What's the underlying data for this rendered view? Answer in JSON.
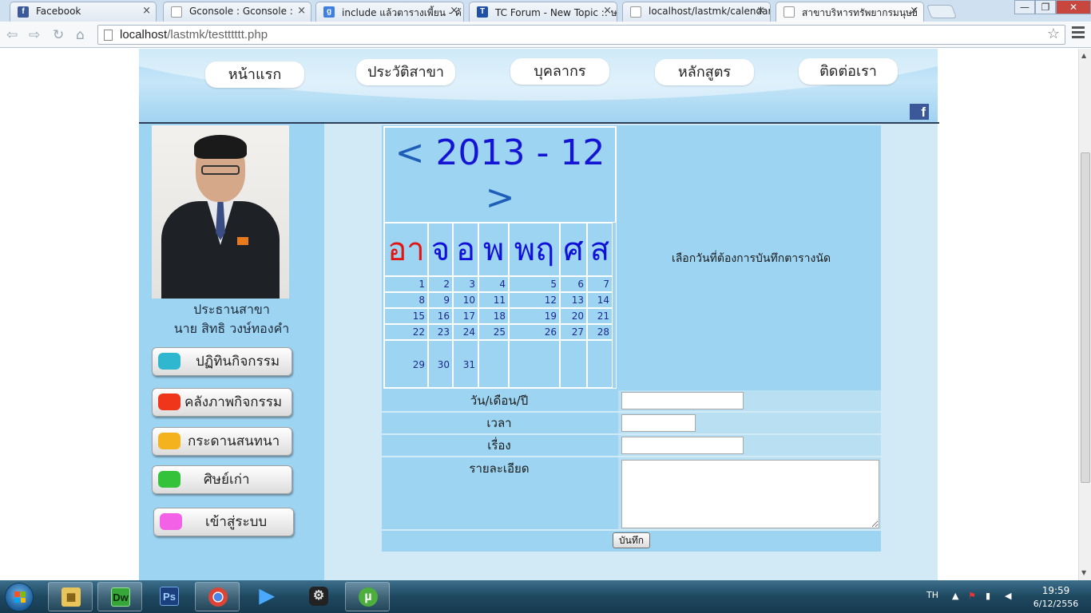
{
  "browser": {
    "tabs": [
      {
        "title": "Facebook",
        "icon": "facebook-icon",
        "icon_color": "#3b5998",
        "icon_glyph": "f"
      },
      {
        "title": "Gconsole : Gconsole :",
        "icon": "page-icon",
        "icon_color": "#ffffff",
        "icon_glyph": ""
      },
      {
        "title": "include แล้วตารางเพี้ยน - ค้",
        "icon": "google-icon",
        "icon_color": "#3f7fe0",
        "icon_glyph": "g"
      },
      {
        "title": "TC Forum - New Topic :: ษ",
        "icon": "forum-icon",
        "icon_color": "#1f4fa6",
        "icon_glyph": "T"
      },
      {
        "title": "localhost/lastmk/calendar",
        "icon": "page-icon",
        "icon_color": "#ffffff",
        "icon_glyph": ""
      },
      {
        "title": "สาขาบริหารทรัพยากรมนุษย์",
        "icon": "page-icon",
        "icon_color": "#ffffff",
        "icon_glyph": ""
      }
    ],
    "close_glyph": "×",
    "window_buttons": {
      "minimize": "—",
      "restore": "❐",
      "close": "✕"
    },
    "nav": {
      "back": "⇦",
      "forward": "⇨",
      "reload": "↻",
      "home": "⌂"
    },
    "url_host": "localhost",
    "url_path": "/lastmk/testttttt.php",
    "star": "☆"
  },
  "site": {
    "nav": [
      "หน้าแรก",
      "ประวัติสาขา",
      "บุคลากร",
      "หลักสูตร",
      "ติดต่อเรา"
    ],
    "facebook_glyph": "f",
    "chair_title": "ประธานสาขา",
    "chair_name": "นาย สิทธิ วงษ์ทองคำ",
    "menu": [
      {
        "label": "ปฏิทินกิจกรรม",
        "color": "#2fb7cf"
      },
      {
        "label": "คลังภาพกิจกรรม",
        "color": "#f0361a"
      },
      {
        "label": "กระดานสนทนา",
        "color": "#f3b21e"
      },
      {
        "label": "ศิษย์เก่า",
        "color": "#33c23a"
      },
      {
        "label": "เข้าสู่ระบบ",
        "color": "#f261e6"
      }
    ],
    "calendar": {
      "prev": "<",
      "next": ">",
      "year_month": "2013 - 12",
      "weekdays": [
        "อา",
        "จ",
        "อ",
        "พ",
        "พฤ",
        "ศ",
        "ส"
      ],
      "weeks": [
        [
          "1",
          "2",
          "3",
          "4",
          "5",
          "6",
          "7"
        ],
        [
          "8",
          "9",
          "10",
          "11",
          "12",
          "13",
          "14"
        ],
        [
          "15",
          "16",
          "17",
          "18",
          "19",
          "20",
          "21"
        ],
        [
          "22",
          "23",
          "24",
          "25",
          "26",
          "27",
          "28"
        ],
        [
          "29",
          "30",
          "31",
          "",
          "",
          "",
          ""
        ]
      ],
      "message": "เลือกวันที่ต้องการบันทึกตารางนัด"
    },
    "form": {
      "date_label": "วัน/เดือน/ปี",
      "time_label": "เวลา",
      "topic_label": "เรื่อง",
      "detail_label": "รายละเอียด",
      "date_value": "",
      "time_value": "",
      "topic_value": "",
      "detail_value": "",
      "save_label": "บันทึก"
    }
  },
  "taskbar": {
    "apps": [
      {
        "name": "file-explorer-icon",
        "glyph": "▦",
        "color": "#e8c45a"
      },
      {
        "name": "dreamweaver-icon",
        "glyph": "Dw",
        "color": "#35a637"
      },
      {
        "name": "photoshop-icon",
        "glyph": "Ps",
        "color": "#1c3f7e"
      },
      {
        "name": "chrome-icon",
        "glyph": "◉",
        "color": "#d8392b"
      },
      {
        "name": "media-player-icon",
        "glyph": "▶",
        "color": "#2f8fe8"
      },
      {
        "name": "steam-icon",
        "glyph": "⚙",
        "color": "#333333"
      },
      {
        "name": "utorrent-icon",
        "glyph": "µ",
        "color": "#4cae3c"
      }
    ],
    "language": "TH",
    "time": "19:59",
    "date": "6/12/2556"
  }
}
